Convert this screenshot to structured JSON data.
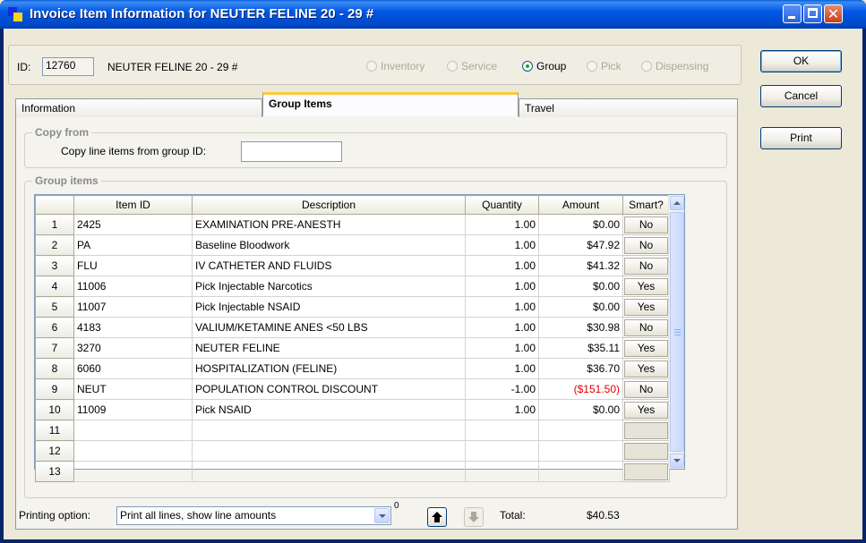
{
  "window": {
    "title": "Invoice Item Information for NEUTER FELINE 20 - 29 #",
    "titlebar_color": "#0054e3"
  },
  "header": {
    "id_label": "ID:",
    "id_value": "12760",
    "item_name": "NEUTER FELINE 20 - 29 #",
    "item_types": [
      {
        "label": "Inventory",
        "selected": false
      },
      {
        "label": "Service",
        "selected": false
      },
      {
        "label": "Group",
        "selected": true
      },
      {
        "label": "Pick",
        "selected": false
      },
      {
        "label": "Dispensing",
        "selected": false
      }
    ]
  },
  "buttons": {
    "ok": "OK",
    "cancel": "Cancel",
    "print": "Print"
  },
  "tabs": [
    {
      "label": "Information",
      "active": false
    },
    {
      "label": "Group Items",
      "active": true
    },
    {
      "label": "Travel",
      "active": false
    }
  ],
  "copy_from": {
    "title": "Copy from",
    "label": "Copy line items from group ID:",
    "value": ""
  },
  "group_items": {
    "title": "Group  items",
    "columns": [
      "",
      "Item ID",
      "Description",
      "Quantity",
      "Amount",
      "Smart?"
    ],
    "rows": [
      {
        "num": "1",
        "item_id": "2425",
        "description": "EXAMINATION PRE-ANESTH",
        "quantity": "1.00",
        "amount": "$0.00",
        "smart": "No"
      },
      {
        "num": "2",
        "item_id": "PA",
        "description": "Baseline Bloodwork",
        "quantity": "1.00",
        "amount": "$47.92",
        "smart": "No"
      },
      {
        "num": "3",
        "item_id": "FLU",
        "description": "IV CATHETER AND FLUIDS",
        "quantity": "1.00",
        "amount": "$41.32",
        "smart": "No"
      },
      {
        "num": "4",
        "item_id": "11006",
        "description": "Pick Injectable Narcotics",
        "quantity": "1.00",
        "amount": "$0.00",
        "smart": "Yes"
      },
      {
        "num": "5",
        "item_id": "11007",
        "description": "Pick Injectable NSAID",
        "quantity": "1.00",
        "amount": "$0.00",
        "smart": "Yes"
      },
      {
        "num": "6",
        "item_id": "4183",
        "description": "VALIUM/KETAMINE ANES <50 LBS",
        "quantity": "1.00",
        "amount": "$30.98",
        "smart": "No"
      },
      {
        "num": "7",
        "item_id": "3270",
        "description": "NEUTER FELINE",
        "quantity": "1.00",
        "amount": "$35.11",
        "smart": "Yes"
      },
      {
        "num": "8",
        "item_id": "6060",
        "description": "HOSPITALIZATION (FELINE)",
        "quantity": "1.00",
        "amount": "$36.70",
        "smart": "Yes"
      },
      {
        "num": "9",
        "item_id": "NEUT",
        "description": "POPULATION CONTROL DISCOUNT",
        "quantity": "-1.00",
        "amount": "($151.50)",
        "smart": "No",
        "negative": true
      },
      {
        "num": "10",
        "item_id": "11009",
        "description": "Pick NSAID",
        "quantity": "1.00",
        "amount": "$0.00",
        "smart": "Yes"
      },
      {
        "num": "11",
        "item_id": "",
        "description": "",
        "quantity": "",
        "amount": "",
        "smart": ""
      },
      {
        "num": "12",
        "item_id": "",
        "description": "",
        "quantity": "",
        "amount": "",
        "smart": ""
      },
      {
        "num": "13",
        "item_id": "",
        "description": "",
        "quantity": "",
        "amount": "",
        "smart": ""
      }
    ],
    "negative_color": "#e00000"
  },
  "footer": {
    "printing_label": "Printing option:",
    "printing_value": "Print all lines, show line amounts",
    "counter": "0",
    "move_up_icon": "arrow-up-icon",
    "move_down_icon": "arrow-down-icon",
    "total_label": "Total:",
    "total_value": "$40.53"
  }
}
